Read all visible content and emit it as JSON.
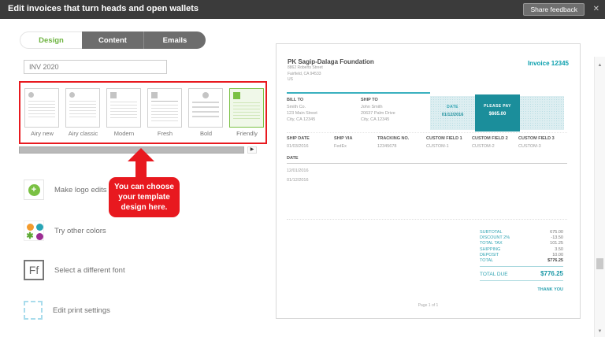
{
  "header": {
    "title": "Edit invoices that turn heads and open wallets",
    "share_feedback_label": "Share feedback"
  },
  "icons": {
    "close": "✕",
    "scroll_right": "▶",
    "scroll_up": "▲",
    "scroll_down": "▼",
    "plus_glyph": "+",
    "asterisk_glyph": "✱",
    "font_glyph": "Ff"
  },
  "tabs": [
    {
      "label": "Design",
      "active": true
    },
    {
      "label": "Content",
      "active": false
    },
    {
      "label": "Emails",
      "active": false
    }
  ],
  "invoice_name_input": {
    "value": "INV 2020"
  },
  "templates": {
    "items": [
      {
        "name": "Airy new",
        "selected": false
      },
      {
        "name": "Airy classic",
        "selected": false
      },
      {
        "name": "Modern",
        "selected": false
      },
      {
        "name": "Fresh",
        "selected": false
      },
      {
        "name": "Bold",
        "selected": false
      },
      {
        "name": "Friendly",
        "selected": true
      }
    ]
  },
  "callout": {
    "text": "You can choose your template design here."
  },
  "sidebar": {
    "options": [
      {
        "label": "Make logo edits",
        "icon": "logo-plus-icon"
      },
      {
        "label": "Try other colors",
        "icon": "color-dots-icon"
      },
      {
        "label": "Select a different font",
        "icon": "font-Ff-icon"
      },
      {
        "label": "Edit print settings",
        "icon": "print-margins-icon"
      }
    ]
  },
  "invoice": {
    "company_name": "PK Sagip-Dalaga Foundation",
    "company_address": [
      "8862 Roberts Street",
      "Fairfield, CA 94533",
      "US"
    ],
    "invoice_number_label": "Invoice 12345",
    "bill_to": {
      "label": "BILL TO",
      "lines": [
        "Smith Co.",
        "123 Main Street",
        "City, CA 12345"
      ]
    },
    "ship_to": {
      "label": "SHIP TO",
      "lines": [
        "John Smith",
        "20637 Palm Drive",
        "City, CA 12345"
      ]
    },
    "date_box": {
      "label": "DATE",
      "value": "01/12/2016"
    },
    "pay_box": {
      "label": "PLEASE PAY",
      "value": "$665.00"
    },
    "meta_columns": [
      {
        "label": "SHIP DATE",
        "value": "01/03/2016"
      },
      {
        "label": "SHIP VIA",
        "value": "FedEx"
      },
      {
        "label": "TRACKING NO.",
        "value": "12345678"
      },
      {
        "label": "CUSTOM FIELD 1",
        "value": "CUSTOM-1"
      },
      {
        "label": "CUSTOM FIELD 2",
        "value": "CUSTOM-2"
      },
      {
        "label": "CUSTOM FIELD 3",
        "value": "CUSTOM-3"
      }
    ],
    "line_table": {
      "header": "DATE",
      "rows": [
        "12/01/2016",
        "01/12/2016"
      ]
    },
    "totals": [
      {
        "label": "SUBTOTAL",
        "value": "675.00"
      },
      {
        "label": "DISCOUNT 2%",
        "value": "-13.50"
      },
      {
        "label": "TOTAL TAX",
        "value": "101.25"
      },
      {
        "label": "SHIPPING",
        "value": "3.50"
      },
      {
        "label": "DEPOSIT",
        "value": "10.00"
      },
      {
        "label": "TOTAL",
        "value": "$776.25"
      }
    ],
    "total_due": {
      "label": "TOTAL DUE",
      "value": "$776.25"
    },
    "thank_you": "THANK YOU",
    "page_footer": "Page 1 of 1"
  },
  "colors": {
    "header_bg": "#3b3b3b",
    "brand_green": "#7ac143",
    "accent_teal": "#0ca0ae",
    "dark_teal": "#1b8e9b",
    "light_teal": "#ddeef1",
    "annotation_red": "#e8191f"
  }
}
